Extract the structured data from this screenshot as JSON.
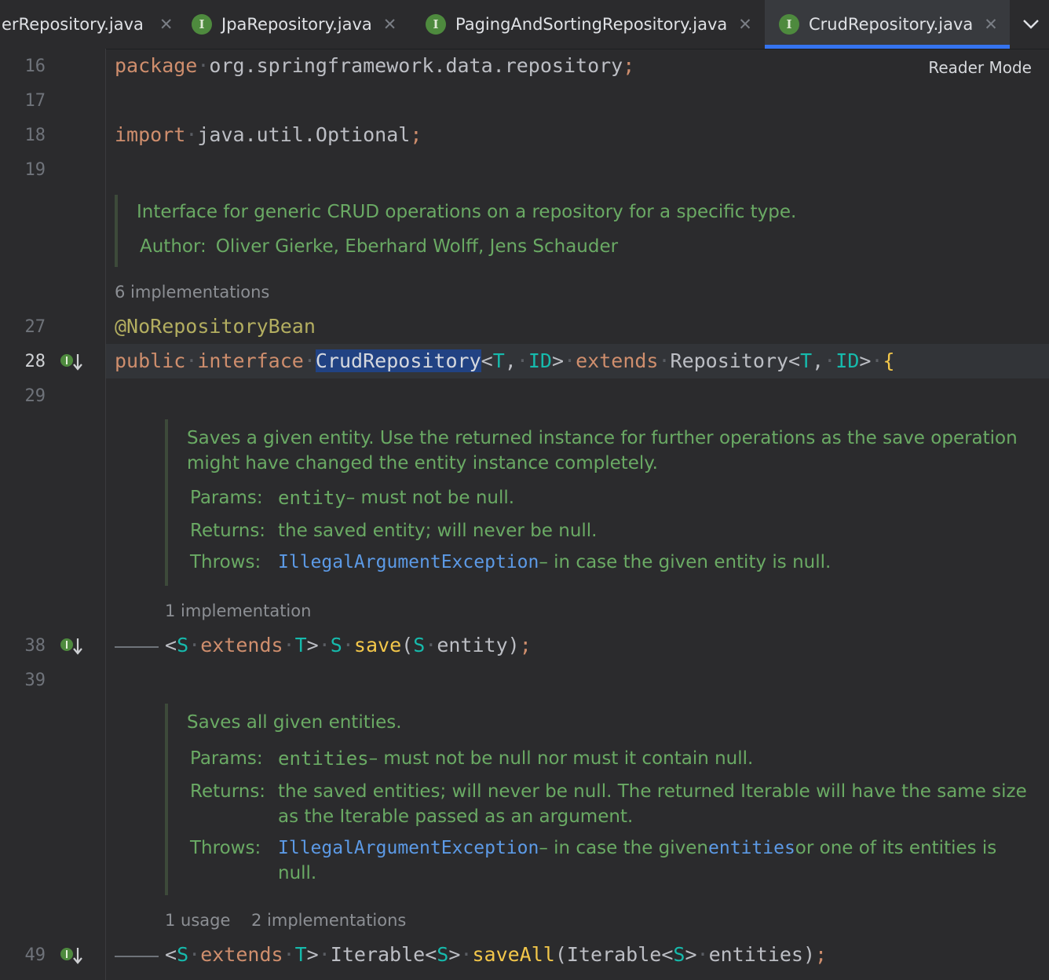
{
  "tabs": [
    {
      "label": "erRepository.java",
      "icon": "interface-icon",
      "active": false
    },
    {
      "label": "JpaRepository.java",
      "icon": "interface-icon",
      "active": false
    },
    {
      "label": "PagingAndSortingRepository.java",
      "icon": "interface-icon",
      "active": false
    },
    {
      "label": "CrudRepository.java",
      "icon": "interface-icon",
      "active": true
    }
  ],
  "tab_icon_letter": "I",
  "close_glyph": "✕",
  "reader_mode": "Reader Mode",
  "line_numbers": {
    "l16": "16",
    "l17": "17",
    "l18": "18",
    "l19": "19",
    "l27": "27",
    "l28": "28",
    "l29": "29",
    "l38": "38",
    "l39": "39",
    "l49": "49"
  },
  "code": {
    "package_kw": "package",
    "package_name": "org.springframework.data.repository",
    "semi": ";",
    "import_kw": "import",
    "import_name": "java.util.Optional",
    "annotation": "@NoRepositoryBean",
    "public_kw": "public",
    "interface_kw": "interface",
    "class_name": "CrudRepository",
    "lt": "<",
    "gt": ">",
    "T": "T",
    "ID": "ID",
    "comma": ",",
    "extends_kw": "extends",
    "repository": "Repository",
    "brace": "{",
    "S": "S",
    "save": "save",
    "lparen": "(",
    "rparen": ")",
    "entity": "entity",
    "Iterable": "Iterable",
    "saveAll": "saveAll",
    "entities": "entities"
  },
  "hints": {
    "impl6": "6 implementations",
    "impl1": "1 implementation",
    "usage1": "1 usage",
    "impl2": "2 implementations"
  },
  "doc_class": {
    "text": "Interface for generic CRUD operations on a repository for a specific type.",
    "author_label": "Author:",
    "author_value": "Oliver Gierke, Eberhard Wolff, Jens Schauder"
  },
  "doc_save": {
    "text1": "Saves a given entity. Use the returned instance for further operations as the save operation",
    "text2": "might have changed the entity instance completely.",
    "params_label": "Params:",
    "params_name": "entity",
    "params_desc": " – must not be null.",
    "returns_label": "Returns:",
    "returns_value": "the saved entity; will never be null.",
    "throws_label": "Throws:",
    "throws_link": "IllegalArgumentException",
    "throws_desc": " – in case the given entity is null."
  },
  "doc_saveall": {
    "text": "Saves all given entities.",
    "params_label": "Params:",
    "params_name": "entities",
    "params_desc": " – must not be null nor must it contain null.",
    "returns_label": "Returns:",
    "returns_value1": "the saved entities; will never be null. The returned Iterable will have the same size",
    "returns_value2": "as the Iterable passed as an argument.",
    "throws_label": "Throws:",
    "throws_link": "IllegalArgumentException",
    "throws_desc1": " – in case the given ",
    "throws_link2": "entities",
    "throws_desc2": " or one of its entities is",
    "throws_desc3": "null."
  }
}
